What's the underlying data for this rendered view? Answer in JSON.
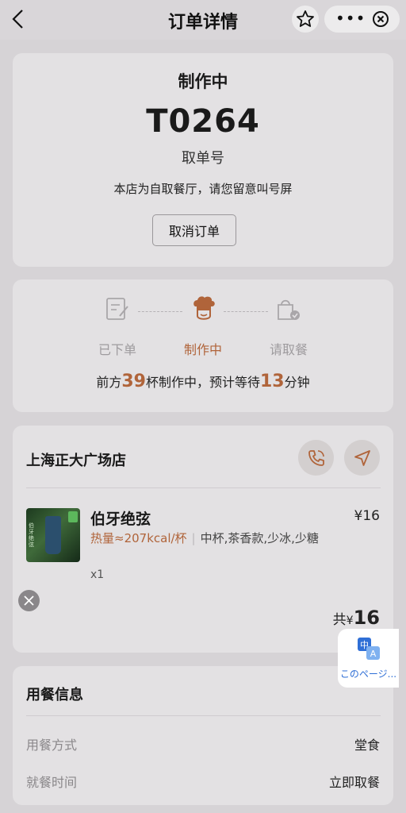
{
  "header": {
    "title": "订单详情"
  },
  "order": {
    "status": "制作中",
    "pickup_number": "T0264",
    "pickup_label": "取单号",
    "notice": "本店为自取餐厅，请您留意叫号屏",
    "cancel_label": "取消订单"
  },
  "progress": {
    "steps": [
      {
        "label": "已下单",
        "icon": "order-note-icon",
        "active": false
      },
      {
        "label": "制作中",
        "icon": "chef-icon",
        "active": true
      },
      {
        "label": "请取餐",
        "icon": "pickup-bag-icon",
        "active": false
      }
    ],
    "queue_prefix": "前方",
    "queue_count": "39",
    "queue_middle": "杯制作中，预计等待",
    "wait_minutes": "13",
    "queue_suffix": "分钟"
  },
  "store": {
    "name": "上海正大广场店"
  },
  "item": {
    "name": "伯牙绝弦",
    "price": "¥16",
    "kcal": "热量≈207kcal/杯",
    "spec": "中杯,茶香款,少冰,少糖",
    "qty": "x1",
    "image_text": "伯牙绝弦"
  },
  "total": {
    "prefix": "共",
    "currency": "¥",
    "amount": "16"
  },
  "translate": {
    "label": "このページ..."
  },
  "dining": {
    "title": "用餐信息",
    "rows": [
      {
        "label": "用餐方式",
        "value": "堂食"
      },
      {
        "label": "就餐时间",
        "value": "立即取餐"
      }
    ]
  },
  "colors": {
    "accent": "#b0643a",
    "background": "#d6d3d6",
    "card": "#e3e1e3"
  }
}
